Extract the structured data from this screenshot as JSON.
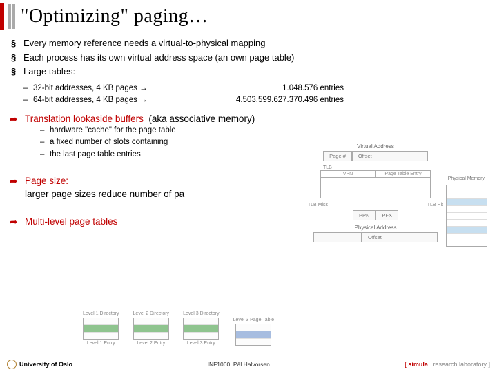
{
  "title": "\"Optimizing\" paging…",
  "bullets": [
    "Every memory reference needs a virtual-to-physical mapping",
    "Each process has its own virtual address space (an own page table)",
    "Large tables:"
  ],
  "table_sub": [
    {
      "left": "32-bit addresses, 4 KB pages →",
      "right": "1.048.576 entries"
    },
    {
      "left": "64-bit addresses, 4 KB pages →",
      "right": "4.503.599.627.370.496 entries"
    }
  ],
  "arrows": {
    "tlb": {
      "head": "Translation lookaside buffers",
      "paren": "(aka associative memory)",
      "sub": [
        "hardware \"cache\" for the page table",
        "a fixed number of slots containing",
        "the last page table entries"
      ]
    },
    "pagesize": {
      "head": "Page size:",
      "line": "larger page sizes reduce number of pa"
    },
    "multilevel": "Multi-level page tables"
  },
  "diagram": {
    "va_title": "Virtual Address",
    "va_cells": [
      "Page #",
      "Offset"
    ],
    "tlb_label": "TLB",
    "tlb_cols": [
      "VPN",
      "Page Table Entry"
    ],
    "miss": "TLB Miss",
    "hit": "TLB Hit",
    "ppn": "PPN",
    "offset": "Offset",
    "pfx": "PFX",
    "pa_title": "Physical Address",
    "phys_title": "Physical Memory"
  },
  "ml": {
    "labels": [
      "Level 1 Directory",
      "Level 2 Directory",
      "Level 3 Directory",
      "Level 3 Page Table"
    ],
    "entries": [
      "Level 1 Entry",
      "Level 2 Entry",
      "Level 3 Entry"
    ]
  },
  "footer": {
    "uio": "University of Oslo",
    "center": "INF1060,   Pål Halvorsen",
    "simula_bracket_open": "[ ",
    "simula_name": "simula",
    "simula_rest": " . research laboratory ]"
  }
}
